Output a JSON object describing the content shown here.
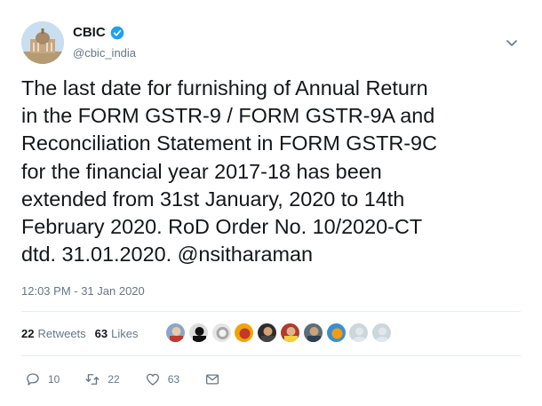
{
  "tweet": {
    "author_name": "CBIC",
    "author_handle": "cbic_india",
    "text": "The last date for furnishing of Annual Return\nin the FORM GSTR-9 / FORM GSTR-9A and\nReconciliation Statement in FORM GSTR-9C\nfor the financial year 2017-18 has been\nextended from 31st January, 2020 to 14th\nFebruary 2020. RoD Order No. 10/2020-CT\ndtd. 31.01.2020. @nsitharaman",
    "timestamp": "12:03 PM - 31 Jan 2020"
  },
  "stats": {
    "retweets_count": "22",
    "retweets_label": "Retweets",
    "likes_count": "63",
    "likes_label": "Likes"
  },
  "actions": {
    "reply_count": "10",
    "retweet_count": "22",
    "like_count": "63"
  },
  "icons": {
    "verified": "verified-badge-icon",
    "menu": "chevron-down-icon",
    "reply": "reply-icon",
    "retweet": "retweet-icon",
    "like": "heart-icon",
    "dm": "envelope-icon"
  },
  "colors": {
    "verified_blue": "#1da1f2",
    "muted_text": "#657786",
    "primary_text": "#14171a"
  }
}
